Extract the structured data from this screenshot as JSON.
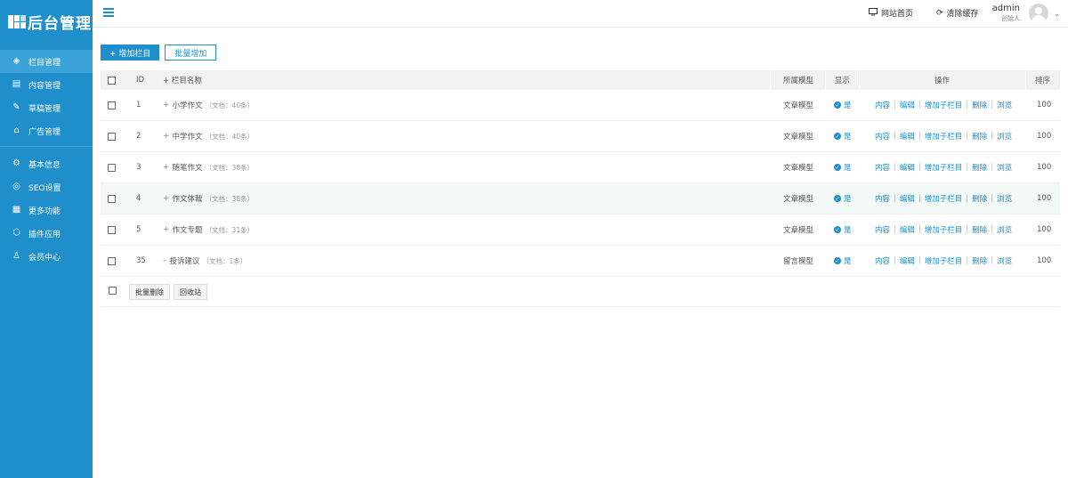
{
  "brand": {
    "logo_text": "后台管理",
    "accent": "#1e8fcb"
  },
  "sidebar": {
    "items": [
      {
        "label": "栏目管理",
        "icon": "layers-icon",
        "glyph": "◈",
        "active": true
      },
      {
        "label": "内容管理",
        "icon": "document-icon",
        "glyph": "▤",
        "active": false
      },
      {
        "label": "草稿管理",
        "icon": "draft-icon",
        "glyph": "✎",
        "active": false
      },
      {
        "label": "广告管理",
        "icon": "ad-icon",
        "glyph": "⌂",
        "active": false
      },
      {
        "label": "基本信息",
        "icon": "gear-icon",
        "glyph": "⚙",
        "active": false
      },
      {
        "label": "SEO设置",
        "icon": "seo-icon",
        "glyph": "◎",
        "active": false
      },
      {
        "label": "更多功能",
        "icon": "grid-icon",
        "glyph": "▦",
        "active": false
      },
      {
        "label": "插件应用",
        "icon": "plugin-icon",
        "glyph": "⬡",
        "active": false
      },
      {
        "label": "会员中心",
        "icon": "user-icon",
        "glyph": "♙",
        "active": false
      }
    ]
  },
  "header": {
    "site_home": "网站首页",
    "clear_cache": "清除缓存",
    "user_name": "admin",
    "user_role": "创始人"
  },
  "toolbar": {
    "add_label": "+ 增加栏目",
    "batch_add_label": "批量增加"
  },
  "table": {
    "headers": {
      "id": "ID",
      "name": "+ 栏目名称",
      "model": "所属模型",
      "show": "显示",
      "ops": "操作",
      "sort": "排序"
    },
    "rows": [
      {
        "id": "1",
        "prefix": "+",
        "name": "小学作文",
        "meta": "（文档：40条）",
        "model": "文章模型",
        "show": "是",
        "sort": "100"
      },
      {
        "id": "2",
        "prefix": "+",
        "name": "中学作文",
        "meta": "（文档：40条）",
        "model": "文章模型",
        "show": "是",
        "sort": "100"
      },
      {
        "id": "3",
        "prefix": "+",
        "name": "随笔作文",
        "meta": "（文档：38条）",
        "model": "文章模型",
        "show": "是",
        "sort": "100"
      },
      {
        "id": "4",
        "prefix": "+",
        "name": "作文体裁",
        "meta": "（文档：38条）",
        "model": "文章模型",
        "show": "是",
        "sort": "100"
      },
      {
        "id": "5",
        "prefix": "+",
        "name": "作文专题",
        "meta": "（文档：31条）",
        "model": "文章模型",
        "show": "是",
        "sort": "100"
      },
      {
        "id": "35",
        "prefix": "–",
        "name": "投诉建议",
        "meta": "（文档：1条）",
        "model": "留言模型",
        "show": "是",
        "sort": "100"
      }
    ],
    "ops": [
      "内容",
      "编辑",
      "增加子栏目",
      "删除",
      "浏览"
    ]
  },
  "footer": {
    "batch_delete": "批量删除",
    "recycle": "回收站"
  }
}
